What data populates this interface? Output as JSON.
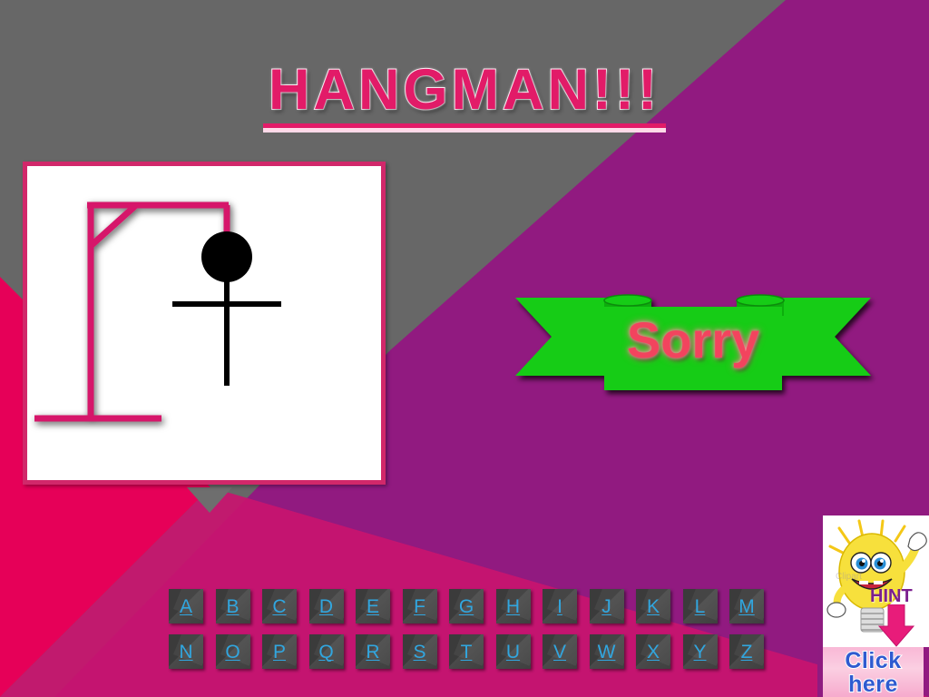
{
  "slide": {
    "title": "HANGMAN!!!",
    "background_gray": "#676767",
    "background_purple": "#911A80",
    "background_pink": "#E60058",
    "accent_crimson": "#D1286A"
  },
  "gallows": {
    "name": "hangman-gallows-drawing",
    "frame_fill": "#FFFFFF",
    "frame_border_color": "#D1286A",
    "structure_color": "#D6156A",
    "figure_color": "#000000",
    "parts_drawn": [
      "base",
      "post",
      "beam",
      "brace",
      "rope",
      "head",
      "arms",
      "body"
    ],
    "wrong_guess_count": "3"
  },
  "banner": {
    "text": "Sorry",
    "ribbon_color": "#12CC12",
    "ribbon_dark": "#0BA30B",
    "text_color": "#F2445E"
  },
  "keyboard": {
    "name": "alphabet-keyboard",
    "letters": [
      "A",
      "B",
      "C",
      "D",
      "E",
      "F",
      "G",
      "H",
      "I",
      "J",
      "K",
      "L",
      "M",
      "N",
      "O",
      "P",
      "Q",
      "R",
      "S",
      "T",
      "U",
      "V",
      "W",
      "X",
      "Y",
      "Z"
    ],
    "key_color": "#3B3B3B",
    "letter_color": "#31A6DF"
  },
  "hint": {
    "label": "HINT",
    "watermark": "Clipart",
    "click_line1": "Click",
    "click_line2": "here",
    "label_color": "#7B1F8F",
    "arrow_color": "#E81C7A",
    "button_color": "#F9B8D6",
    "button_text_color": "#2F5BD0",
    "bulb_color": "#F7E03C",
    "icon": "lightbulb-character-icon"
  }
}
